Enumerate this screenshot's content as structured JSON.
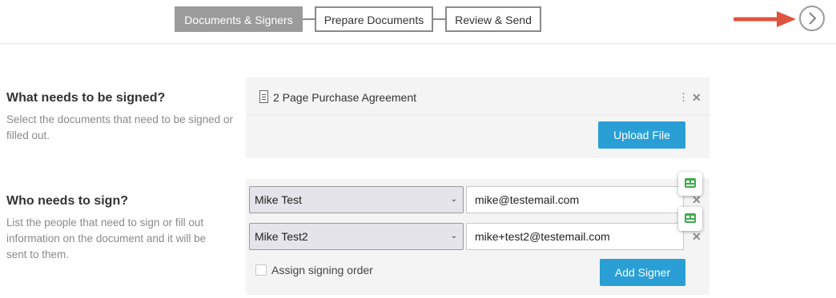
{
  "steps": [
    {
      "label": "Documents & Signers",
      "active": true
    },
    {
      "label": "Prepare Documents",
      "active": false
    },
    {
      "label": "Review & Send",
      "active": false
    }
  ],
  "documents_section": {
    "title": "What needs to be signed?",
    "description": "Select the documents that need to be signed or filled out.",
    "document_name": "2 Page Purchase Agreement",
    "upload_label": "Upload File"
  },
  "signers_section": {
    "title": "Who needs to sign?",
    "description": "List the people that need to sign or fill out information on the document and it will be sent to them.",
    "signers": [
      {
        "name": "Mike Test",
        "email": "mike@testemail.com"
      },
      {
        "name": "Mike Test2",
        "email": "mike+test2@testemail.com"
      }
    ],
    "signing_order_label": "Assign signing order",
    "add_signer_label": "Add Signer"
  },
  "icons": {
    "next": "chevron-right-icon",
    "annotation_arrow": "red-arrow-icon",
    "document": "document-icon",
    "menu": "kebab-menu-icon",
    "remove": "close-icon",
    "caret": "chevron-down-icon",
    "badge": "signer-badge-icon"
  },
  "colors": {
    "active_step": "#9b9b9b",
    "accent_blue": "#2a9fd6",
    "arrow_red": "#e0533f",
    "badge_green": "#3daa4e"
  }
}
